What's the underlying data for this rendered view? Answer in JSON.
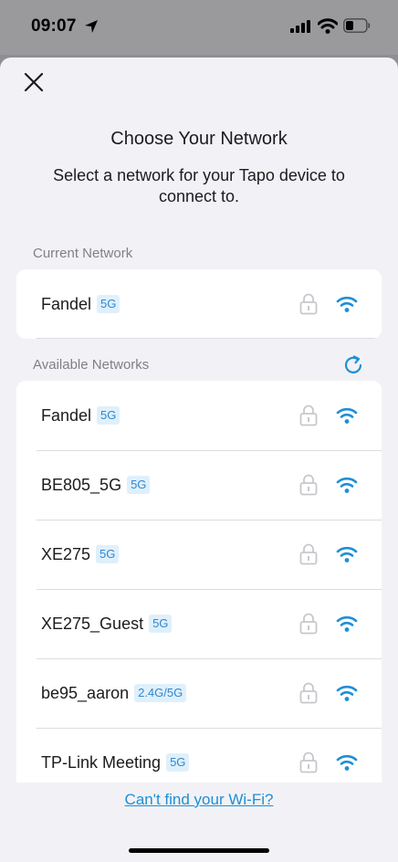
{
  "status_bar": {
    "time": "09:07"
  },
  "header": {
    "title": "Choose Your Network",
    "subtitle": "Select a network for your Tapo device to connect to."
  },
  "current_section": {
    "label": "Current Network",
    "network": {
      "ssid": "Fandel",
      "band": "5G"
    }
  },
  "available_section": {
    "label": "Available Networks",
    "networks": [
      {
        "ssid": "Fandel",
        "band": "5G"
      },
      {
        "ssid": "BE805_5G",
        "band": "5G"
      },
      {
        "ssid": "XE275",
        "band": "5G"
      },
      {
        "ssid": "XE275_Guest",
        "band": "5G"
      },
      {
        "ssid": "be95_aaron",
        "band": "2.4G/5G"
      },
      {
        "ssid": "TP-Link Meeting",
        "band": "5G"
      }
    ]
  },
  "footer": {
    "cant_find_link": "Can't find your Wi-Fi?"
  },
  "colors": {
    "accent": "#1e8fd6",
    "band_bg": "#dff0fb",
    "sheet_bg": "#f2f2f6"
  },
  "icons": [
    "location-arrow-icon",
    "signal-bars-icon",
    "wifi-status-icon",
    "battery-icon",
    "close-icon",
    "lock-icon",
    "wifi-icon",
    "refresh-icon"
  ]
}
